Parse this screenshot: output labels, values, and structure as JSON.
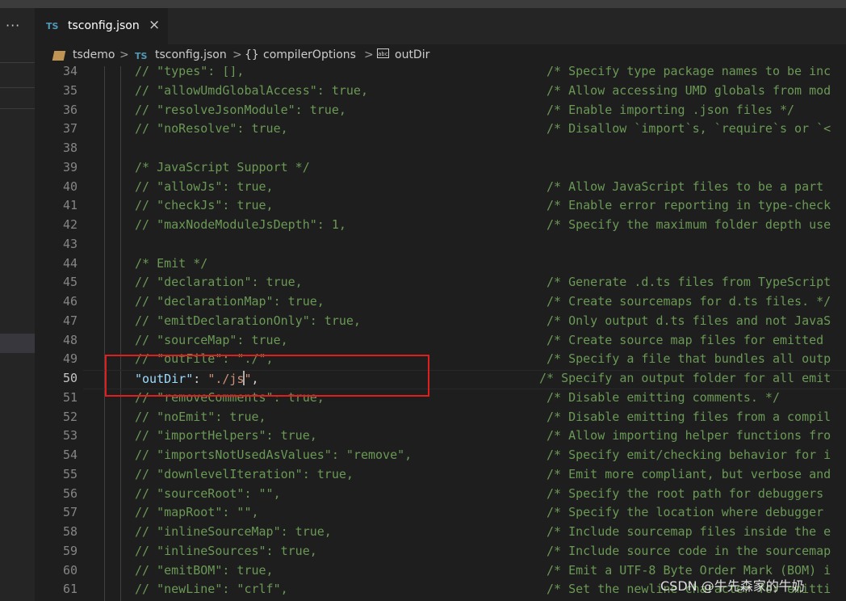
{
  "tab": {
    "label": "tsconfig.json",
    "icon": "TS",
    "close": "×"
  },
  "sidebar": {
    "more": "···"
  },
  "breadcrumb": {
    "folder": "tsdemo",
    "file": "tsconfig.json",
    "section": "compilerOptions",
    "item": "outDir",
    "separator": ">"
  },
  "editor": {
    "active_line": 50,
    "lines": [
      {
        "n": "34",
        "code": "// \"types\": [],",
        "comment": "/* Specify type package names to be inc"
      },
      {
        "n": "35",
        "code": "// \"allowUmdGlobalAccess\": true,",
        "comment": "/* Allow accessing UMD globals from mod"
      },
      {
        "n": "36",
        "code": "// \"resolveJsonModule\": true,",
        "comment": "/* Enable importing .json files */"
      },
      {
        "n": "37",
        "code": "// \"noResolve\": true,",
        "comment": "/* Disallow `import`s, `require`s or `<"
      },
      {
        "n": "38",
        "code": "",
        "comment": ""
      },
      {
        "n": "39",
        "code": "/* JavaScript Support */",
        "comment": ""
      },
      {
        "n": "40",
        "code": "// \"allowJs\": true,",
        "comment": "/* Allow JavaScript files to be a part"
      },
      {
        "n": "41",
        "code": "// \"checkJs\": true,",
        "comment": "/* Enable error reporting in type-check"
      },
      {
        "n": "42",
        "code": "// \"maxNodeModuleJsDepth\": 1,",
        "comment": "/* Specify the maximum folder depth use"
      },
      {
        "n": "43",
        "code": "",
        "comment": ""
      },
      {
        "n": "44",
        "code": "/* Emit */",
        "comment": ""
      },
      {
        "n": "45",
        "code": "// \"declaration\": true,",
        "comment": "/* Generate .d.ts files from TypeScript"
      },
      {
        "n": "46",
        "code": "// \"declarationMap\": true,",
        "comment": "/* Create sourcemaps for d.ts files. */"
      },
      {
        "n": "47",
        "code": "// \"emitDeclarationOnly\": true,",
        "comment": "/* Only output d.ts files and not JavaS"
      },
      {
        "n": "48",
        "code": "// \"sourceMap\": true,",
        "comment": "/* Create source map files for emitted"
      },
      {
        "n": "49",
        "code": "// \"outFile\": \"./\",",
        "comment": "/* Specify a file that bundles all outp"
      },
      {
        "n": "50",
        "code": "",
        "comment": "/* Specify an output folder for all emit"
      },
      {
        "n": "51",
        "code": "// \"removeComments\": true,",
        "comment": "/* Disable emitting comments. */"
      },
      {
        "n": "52",
        "code": "// \"noEmit\": true,",
        "comment": "/* Disable emitting files from a compil"
      },
      {
        "n": "53",
        "code": "// \"importHelpers\": true,",
        "comment": "/* Allow importing helper functions fro"
      },
      {
        "n": "54",
        "code": "// \"importsNotUsedAsValues\": \"remove\",",
        "comment": "/* Specify emit/checking behavior for i"
      },
      {
        "n": "55",
        "code": "// \"downlevelIteration\": true,",
        "comment": "/* Emit more compliant, but verbose and"
      },
      {
        "n": "56",
        "code": "// \"sourceRoot\": \"\",",
        "comment": "/* Specify the root path for debuggers"
      },
      {
        "n": "57",
        "code": "// \"mapRoot\": \"\",",
        "comment": "/* Specify the location where debugger"
      },
      {
        "n": "58",
        "code": "// \"inlineSourceMap\": true,",
        "comment": "/* Include sourcemap files inside the e"
      },
      {
        "n": "59",
        "code": "// \"inlineSources\": true,",
        "comment": "/* Include source code in the sourcemap"
      },
      {
        "n": "60",
        "code": "// \"emitBOM\": true,",
        "comment": "/* Emit a UTF-8 Byte Order Mark (BOM) i"
      },
      {
        "n": "61",
        "code": "// \"newLine\": \"crlf\",",
        "comment": "/* Set the newline character for emitti"
      }
    ],
    "outdir_line": {
      "key": "\"outDir\"",
      "colon": ": ",
      "value_a": "\"./js",
      "value_b": "\"",
      "comma": ","
    }
  },
  "watermark": "CSDN @牛先森家的牛奶",
  "colors": {
    "comment": "#6a9955",
    "key": "#9cdcfe",
    "string": "#ce9178",
    "highlight_box": "#e01e1e",
    "ts_icon": "#519aba"
  }
}
